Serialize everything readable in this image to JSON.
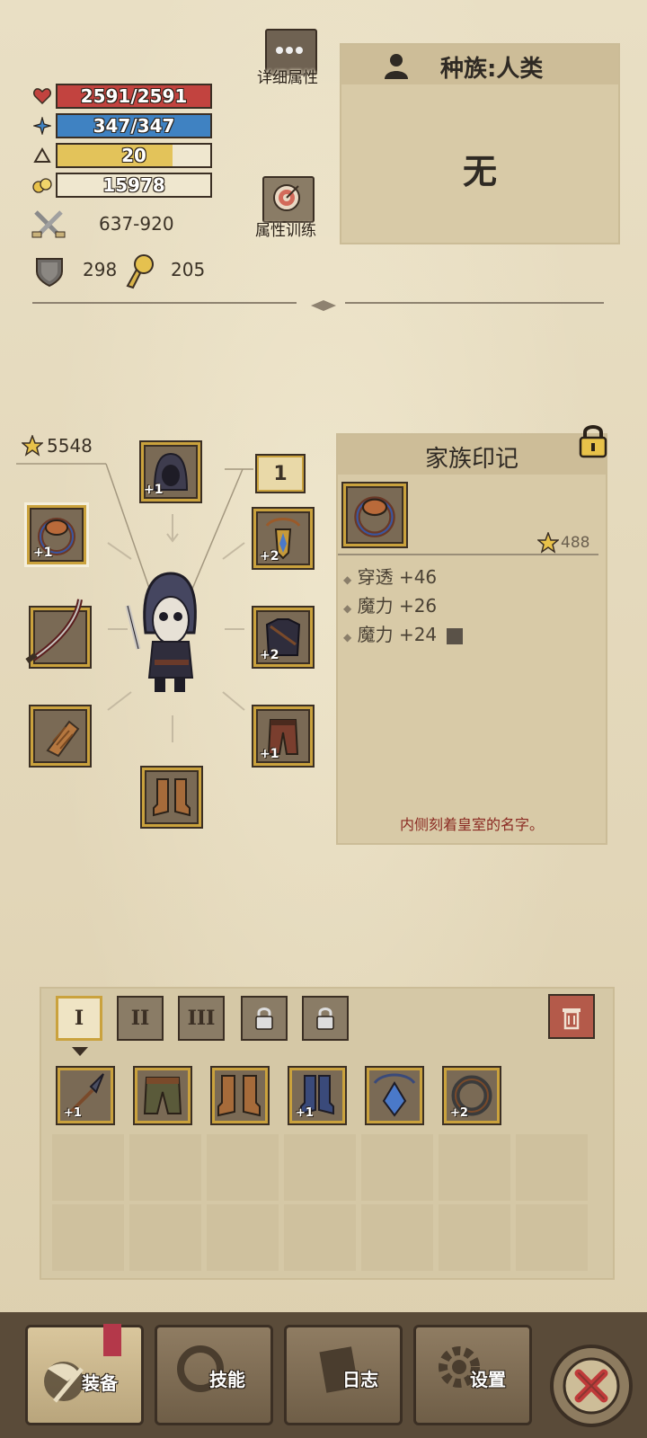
{
  "stats": {
    "hp": {
      "text": "2591/2591",
      "fraction": 1.0,
      "color": "#c2433f"
    },
    "mp": {
      "text": "347/347",
      "fraction": 1.0,
      "color": "#3f82c2"
    },
    "level": {
      "text": "20",
      "fraction": 0.75,
      "color": "#e3c35a"
    },
    "gold": {
      "text": "15978",
      "fraction": 0.0,
      "color": "#efe7cf"
    },
    "attack": "637-920",
    "defense": "298",
    "magic_resist": "205"
  },
  "top_buttons": {
    "detail_label": "详细属性",
    "training_label": "属性训练"
  },
  "race_panel": {
    "title": "种族:人类",
    "value": "无"
  },
  "equipment": {
    "gear_score": "5548",
    "level_badge": "1",
    "slots": {
      "head_plus": "+1",
      "ring_plus": "+1",
      "necklace_plus": "+2",
      "armor_plus": "+2",
      "pants_plus": "+1"
    }
  },
  "item_detail": {
    "title": "家族印记",
    "score": "488",
    "affixes": [
      "穿透 +46",
      "魔力 +26",
      "魔力 +24"
    ],
    "description": "内侧刻着皇室的名字。"
  },
  "inventory": {
    "tabs": [
      "I",
      "II",
      "III"
    ],
    "items": [
      {
        "icon": "spear-item-icon",
        "plus": "+1"
      },
      {
        "icon": "leather-pants-icon",
        "plus": ""
      },
      {
        "icon": "boots-icon",
        "plus": ""
      },
      {
        "icon": "blue-boots-icon",
        "plus": "+1"
      },
      {
        "icon": "blue-amulet-icon",
        "plus": ""
      },
      {
        "icon": "dark-ring-icon",
        "plus": "+2"
      }
    ]
  },
  "nav": {
    "equipment": "装备",
    "skills": "技能",
    "log": "日志",
    "settings": "设置"
  },
  "colors": {
    "parchment": "#e6dcc0",
    "gold_frame": "#caa23d",
    "close_red": "#c03a3a"
  }
}
